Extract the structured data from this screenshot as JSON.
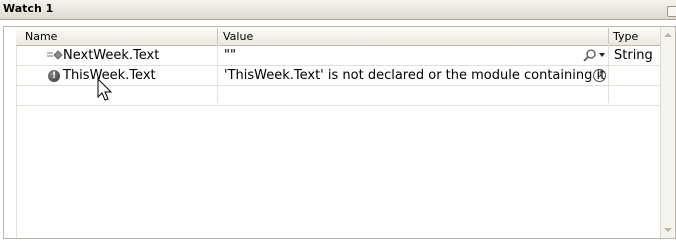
{
  "window": {
    "title": "Watch 1"
  },
  "columns": {
    "name": "Name",
    "value": "Value",
    "type": "Type"
  },
  "rows": [
    {
      "name": "NextWeek.Text",
      "value": "\"\"",
      "type": "String",
      "icon": "property-icon",
      "has_search": true
    },
    {
      "name": "ThisWeek.Text",
      "value": "'ThisWeek.Text' is not declared or the module containing it",
      "type": "",
      "icon": "error-icon",
      "error_glyph": "!",
      "expand_glyph": "⇓"
    }
  ]
}
